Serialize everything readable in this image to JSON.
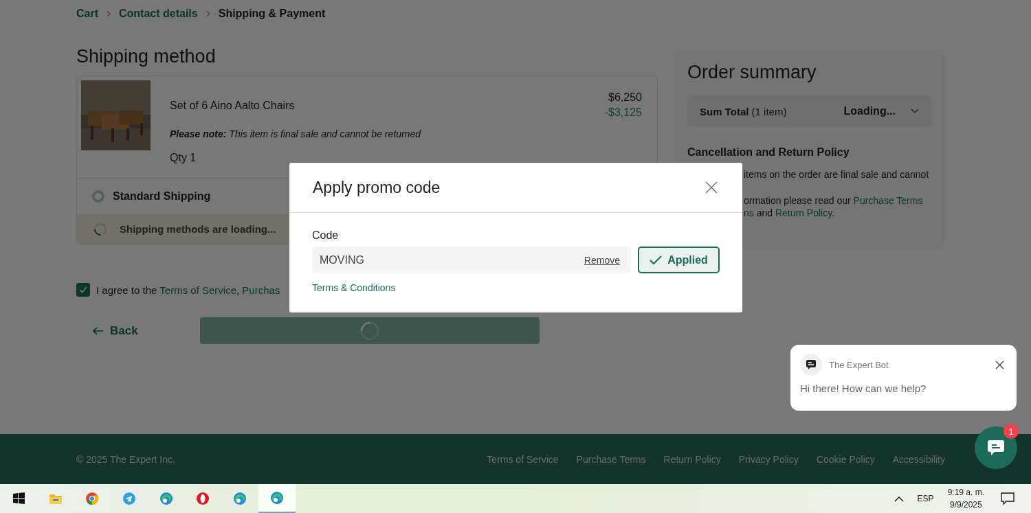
{
  "breadcrumb": [
    {
      "label": "Cart",
      "current": false
    },
    {
      "label": "Contact details",
      "current": false
    },
    {
      "label": "Shipping & Payment",
      "current": true
    }
  ],
  "shipping": {
    "title": "Shipping method",
    "item": {
      "kind": "picture",
      "name": "Set of 6 Aino Aalto Chairs",
      "price": "$6,250",
      "discount": "-$3,125",
      "note": "**Please note:** This item is final sale and cannot be returned",
      "qty": "Qty 1"
    },
    "options": [
      {
        "label": "Standard Shipping",
        "selected": false
      }
    ],
    "loading": "Shipping methods are loading..."
  },
  "agree": {
    "checked": true,
    "parts": [
      {
        "kind": "text",
        "text": "I agree to the "
      },
      {
        "kind": "link",
        "text": "Terms of Service"
      },
      {
        "kind": "text",
        "text": ", "
      },
      {
        "kind": "link",
        "text": "Purchas"
      }
    ]
  },
  "back": "Back",
  "continue": {
    "loading": true
  },
  "summary": {
    "title": "Order summary",
    "total_label": "Sum Total",
    "total_count": "(1 item)",
    "total_value": "Loading...",
    "expanded": false,
    "policy_title": "Cancellation and Return Policy",
    "policy_lines": [
      [
        {
          "kind": "text",
          "text": "items on the order are final sale and cannot"
        }
      ],
      [
        {
          "kind": "text",
          "text": "ormation please read our "
        },
        {
          "kind": "link",
          "text": "Purchase Terms"
        }
      ],
      [
        {
          "kind": "link",
          "text": "ns"
        },
        {
          "kind": "text",
          "text": " and "
        },
        {
          "kind": "link",
          "text": "Return Policy"
        },
        {
          "kind": "text",
          "text": "."
        }
      ]
    ]
  },
  "modal": {
    "title": "Apply promo code",
    "label": "Code",
    "value": "MOVING",
    "remove": "Remove",
    "button": "Applied",
    "applied": true,
    "terms": "Terms & Conditions"
  },
  "chat": {
    "bot": "The Expert Bot",
    "message": "Hi there! How can we help?",
    "badge": "1"
  },
  "footer": {
    "copyright": "© 2025 The Expert Inc.",
    "links": [
      "Terms of Service",
      "Purchase Terms",
      "Return Policy",
      "Privacy Policy",
      "Cookie Policy",
      "Accessibility"
    ]
  },
  "taskbar": {
    "apps": [
      {
        "kind": "start",
        "selected": false
      },
      {
        "kind": "folder",
        "selected": false
      },
      {
        "kind": "chrome",
        "selected": false
      },
      {
        "kind": "telegram",
        "selected": false
      },
      {
        "kind": "edge",
        "selected": false
      },
      {
        "kind": "opera",
        "selected": false
      },
      {
        "kind": "edge",
        "selected": false
      },
      {
        "kind": "edge",
        "selected": true
      }
    ],
    "language": "ESP",
    "time": "9:19 a. m.",
    "date": "9/9/2025"
  }
}
